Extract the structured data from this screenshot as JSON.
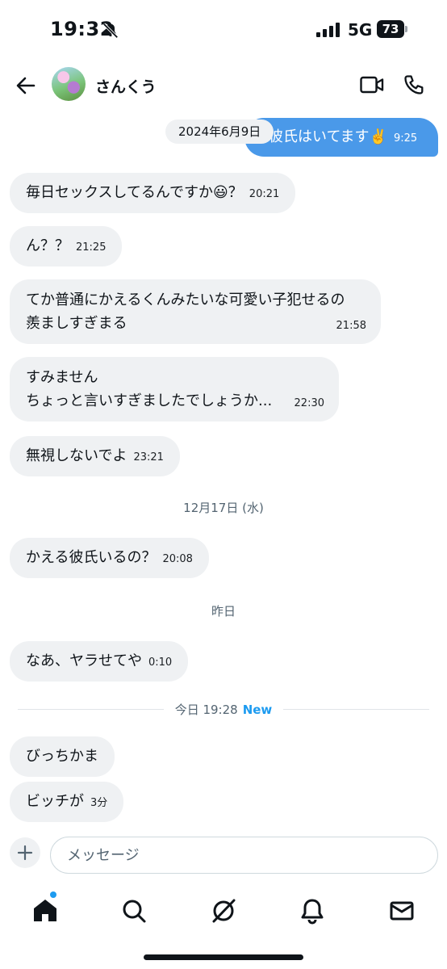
{
  "status_bar": {
    "time": "19:32",
    "network": "5G",
    "battery": "73"
  },
  "header": {
    "contact_name": "さんくう"
  },
  "chat": {
    "outgoing": {
      "text": "彼氏はいてます✌️",
      "time": "9:25"
    },
    "date_chip": "2024年6月9日",
    "messages": [
      {
        "lines": [
          "毎日セックスしてるんですか😃？"
        ],
        "time": "20:21"
      },
      {
        "lines": [
          "ん？？"
        ],
        "time": "21:25"
      },
      {
        "lines": [
          "てか普通にかえるくんみたいな可愛い子犯せるの",
          "羨ましすぎまる"
        ],
        "time": "21:58"
      },
      {
        "lines": [
          "すみません",
          "ちょっと言いすぎましたでしょうか..."
        ],
        "time": "22:30"
      },
      {
        "lines": [
          "無視しないでよ"
        ],
        "time": "23:21"
      },
      {
        "lines": [
          "かえる彼氏いるの？"
        ],
        "time": "20:08"
      },
      {
        "lines": [
          "なあ、ヤラせてや"
        ],
        "time": "0:10"
      },
      {
        "lines": [
          "びっちかま"
        ],
        "time": ""
      },
      {
        "lines": [
          "ビッチが"
        ],
        "time": "3分"
      }
    ],
    "date_separators": [
      "12月17日 (水)",
      "昨日"
    ],
    "new_divider": {
      "label": "今日 19:28",
      "badge": "New"
    }
  },
  "composer": {
    "placeholder": "メッセージ"
  },
  "nav": {
    "items": [
      "home-icon",
      "search-icon",
      "grok-icon",
      "notifications-icon",
      "messages-icon"
    ],
    "badge_color": "#1d9bf0"
  }
}
